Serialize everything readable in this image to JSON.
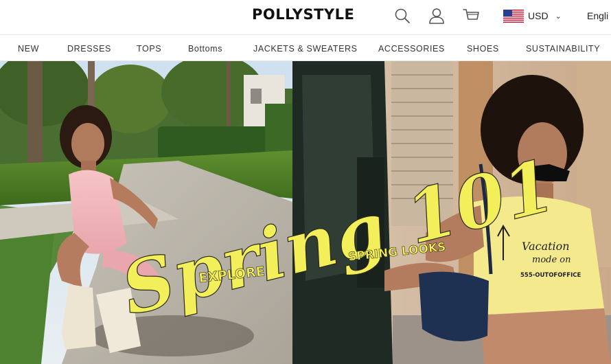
{
  "brand": {
    "name": "POLLYSTYLE"
  },
  "header": {
    "icons": [
      "search-icon",
      "account-icon",
      "cart-icon"
    ],
    "currency": {
      "code": "USD",
      "flag": "us-flag"
    },
    "language": "Engli"
  },
  "nav": {
    "items": [
      {
        "label": "NEW"
      },
      {
        "label": "DRESSES"
      },
      {
        "label": "TOPS"
      },
      {
        "label": "Bottoms"
      },
      {
        "label": "JACKETS & SWEATERS"
      },
      {
        "label": "ACCESSORIES"
      },
      {
        "label": "SHOES"
      },
      {
        "label": "SUSTAINABILITY"
      }
    ]
  },
  "hero": {
    "headline": "Spring 101",
    "explore_label": "EXPLORE",
    "looks_label": "SPRING LOOKS",
    "shirt_text_line1": "Vacation",
    "shirt_text_line2": "mode on",
    "shirt_text_line3": "555-OUTOFOFFICE",
    "accent_color": "#f3ef5a"
  }
}
